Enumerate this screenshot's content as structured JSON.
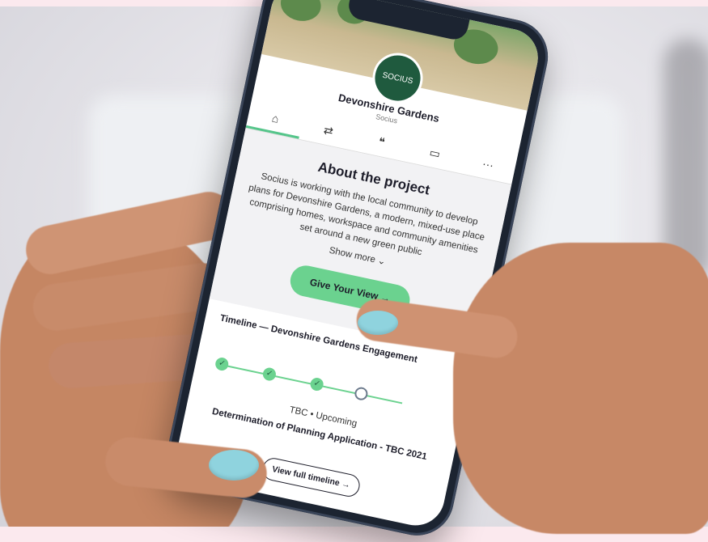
{
  "project": {
    "logo_text": "SOCIUS",
    "title": "Devonshire Gardens",
    "subtitle": "Socius"
  },
  "tabs": [
    {
      "icon": "home-icon",
      "glyph": "⌂"
    },
    {
      "icon": "swap-icon",
      "glyph": "⇄"
    },
    {
      "icon": "chat-icon",
      "glyph": "❝"
    },
    {
      "icon": "message-icon",
      "glyph": "▭"
    },
    {
      "icon": "more-icon",
      "glyph": "···"
    }
  ],
  "about": {
    "heading": "About the project",
    "body": "Socius is working with the local community to develop plans for Devonshire Gardens, a modern, mixed-use place comprising homes, workspace and community amenities set around a new green public",
    "show_more": "Show more ⌄",
    "cta": "Give Your View →"
  },
  "timeline": {
    "title": "Timeline — Devonshire Gardens Engagement",
    "status": "TBC  • Upcoming",
    "milestone": "Determination of Planning Application - TBC 2021",
    "cta": "View full timeline →",
    "progress": 0.75
  },
  "colors": {
    "accent": "#6bd28f",
    "brand": "#1f5a3e",
    "background": "#fbe9ee",
    "nail": "#8fd3de"
  }
}
